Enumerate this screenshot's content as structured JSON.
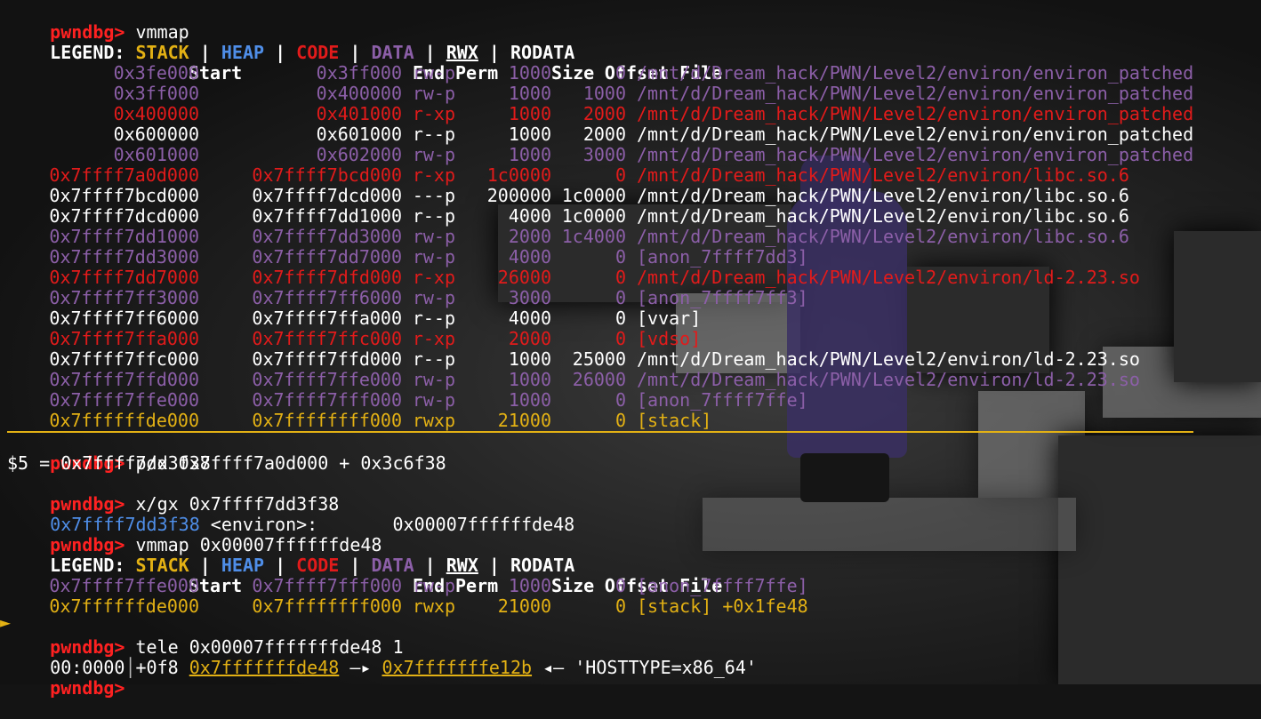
{
  "colors": {
    "prompt": "#ff2121",
    "stack": "#e3b114",
    "heap": "#4f8ee8",
    "code": "#e21b1b",
    "data": "#8c5fa8",
    "rodata": "#ffffff"
  },
  "prompt": "pwndbg>",
  "commands": [
    " vmmap",
    " p/x 0x7ffff7a0d000 + 0x3c6f38",
    " x/gx 0x7ffff7dd3f38",
    " vmmap 0x00007ffffffde48",
    " tele 0x00007fffffffde48 1",
    ""
  ],
  "legend": {
    "label": "LEGEND:",
    "stack": "STACK",
    "heap": "HEAP",
    "code": "CODE",
    "data": "DATA",
    "rwx": "RWX",
    "rodata": "RODATA",
    "sep": " | "
  },
  "header": {
    "start": "Start",
    "end": "End",
    "perm": "Perm",
    "size": "Size",
    "offset": "Offset",
    "file": "File"
  },
  "vmmap1": [
    {
      "start": "0x3fe000",
      "end": "0x3ff000",
      "perm": "rw-p",
      "size": "1000",
      "offset": "0",
      "file": "/mnt/d/Dream_hack/PWN/Level2/environ/environ_patched",
      "kind": "data"
    },
    {
      "start": "0x3ff000",
      "end": "0x400000",
      "perm": "rw-p",
      "size": "1000",
      "offset": "1000",
      "file": "/mnt/d/Dream_hack/PWN/Level2/environ/environ_patched",
      "kind": "data"
    },
    {
      "start": "0x400000",
      "end": "0x401000",
      "perm": "r-xp",
      "size": "1000",
      "offset": "2000",
      "file": "/mnt/d/Dream_hack/PWN/Level2/environ/environ_patched",
      "kind": "code"
    },
    {
      "start": "0x600000",
      "end": "0x601000",
      "perm": "r--p",
      "size": "1000",
      "offset": "2000",
      "file": "/mnt/d/Dream_hack/PWN/Level2/environ/environ_patched",
      "kind": "rodata"
    },
    {
      "start": "0x601000",
      "end": "0x602000",
      "perm": "rw-p",
      "size": "1000",
      "offset": "3000",
      "file": "/mnt/d/Dream_hack/PWN/Level2/environ/environ_patched",
      "kind": "data"
    },
    {
      "start": "0x7ffff7a0d000",
      "end": "0x7ffff7bcd000",
      "perm": "r-xp",
      "size": "1c0000",
      "offset": "0",
      "file": "/mnt/d/Dream_hack/PWN/Level2/environ/libc.so.6",
      "kind": "code"
    },
    {
      "start": "0x7ffff7bcd000",
      "end": "0x7ffff7dcd000",
      "perm": "---p",
      "size": "200000",
      "offset": "1c0000",
      "file": "/mnt/d/Dream_hack/PWN/Level2/environ/libc.so.6",
      "kind": "rodata"
    },
    {
      "start": "0x7ffff7dcd000",
      "end": "0x7ffff7dd1000",
      "perm": "r--p",
      "size": "4000",
      "offset": "1c0000",
      "file": "/mnt/d/Dream_hack/PWN/Level2/environ/libc.so.6",
      "kind": "rodata"
    },
    {
      "start": "0x7ffff7dd1000",
      "end": "0x7ffff7dd3000",
      "perm": "rw-p",
      "size": "2000",
      "offset": "1c4000",
      "file": "/mnt/d/Dream_hack/PWN/Level2/environ/libc.so.6",
      "kind": "data"
    },
    {
      "start": "0x7ffff7dd3000",
      "end": "0x7ffff7dd7000",
      "perm": "rw-p",
      "size": "4000",
      "offset": "0",
      "file": "[anon_7ffff7dd3]",
      "kind": "data"
    },
    {
      "start": "0x7ffff7dd7000",
      "end": "0x7ffff7dfd000",
      "perm": "r-xp",
      "size": "26000",
      "offset": "0",
      "file": "/mnt/d/Dream_hack/PWN/Level2/environ/ld-2.23.so",
      "kind": "code"
    },
    {
      "start": "0x7ffff7ff3000",
      "end": "0x7ffff7ff6000",
      "perm": "rw-p",
      "size": "3000",
      "offset": "0",
      "file": "[anon_7ffff7ff3]",
      "kind": "data"
    },
    {
      "start": "0x7ffff7ff6000",
      "end": "0x7ffff7ffa000",
      "perm": "r--p",
      "size": "4000",
      "offset": "0",
      "file": "[vvar]",
      "kind": "rodata"
    },
    {
      "start": "0x7ffff7ffa000",
      "end": "0x7ffff7ffc000",
      "perm": "r-xp",
      "size": "2000",
      "offset": "0",
      "file": "[vdso]",
      "kind": "code"
    },
    {
      "start": "0x7ffff7ffc000",
      "end": "0x7ffff7ffd000",
      "perm": "r--p",
      "size": "1000",
      "offset": "25000",
      "file": "/mnt/d/Dream_hack/PWN/Level2/environ/ld-2.23.so",
      "kind": "rodata"
    },
    {
      "start": "0x7ffff7ffd000",
      "end": "0x7ffff7ffe000",
      "perm": "rw-p",
      "size": "1000",
      "offset": "26000",
      "file": "/mnt/d/Dream_hack/PWN/Level2/environ/ld-2.23.so",
      "kind": "data"
    },
    {
      "start": "0x7ffff7ffe000",
      "end": "0x7ffff7fff000",
      "perm": "rw-p",
      "size": "1000",
      "offset": "0",
      "file": "[anon_7ffff7ffe]",
      "kind": "data"
    },
    {
      "start": "0x7ffffffde000",
      "end": "0x7ffffffff000",
      "perm": "rwxp",
      "size": "21000",
      "offset": "0",
      "file": "[stack]",
      "kind": "stack"
    }
  ],
  "print_result": "$5 = 0x7ffff7dd3f38",
  "xgx_result": {
    "addr": "0x7ffff7dd3f38",
    "sym": " <environ>:",
    "val": "       0x00007ffffffde48"
  },
  "vmmap2": [
    {
      "marker": "",
      "start": "0x7ffff7ffe000",
      "end": "0x7ffff7fff000",
      "perm": "rw-p",
      "size": "1000",
      "offset": "0",
      "file": "[anon_7ffff7ffe]",
      "kind": "data"
    },
    {
      "marker": "►",
      "start": "0x7ffffffde000",
      "end": "0x7ffffffff000",
      "perm": "rwxp",
      "size": "21000",
      "offset": "0",
      "file": "[stack] +0x1fe48",
      "kind": "stack"
    }
  ],
  "tele": {
    "idx": "00:0000",
    "bar": "│",
    "off": "+0f8 ",
    "addr1": "0x7fffffffde48",
    "arrow1": " —▸ ",
    "addr2": "0x7fffffffe12b",
    "arrow2": " ◂— ",
    "str": "'HOSTTYPE=x86_64'"
  }
}
